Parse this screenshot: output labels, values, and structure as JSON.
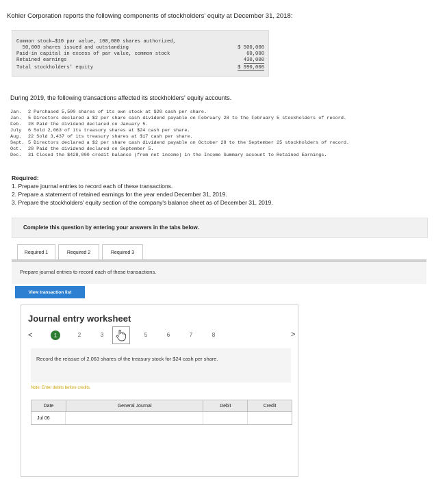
{
  "intro": "Kohler Corporation reports the following components of stockholders' equity at December 31, 2018:",
  "equity": {
    "rows": [
      {
        "label": "Common stock—$10 par value, 100,000 shares authorized,",
        "amount": ""
      },
      {
        "label": "  50,000 shares issued and outstanding",
        "amount": "$ 500,000"
      },
      {
        "label": "Paid-in capital in excess of par value, common stock",
        "amount": "60,000"
      },
      {
        "label": "Retained earnings",
        "amount": "430,000"
      },
      {
        "label": "Total stockholders' equity",
        "amount": "$ 990,000"
      }
    ]
  },
  "during": "During 2019, the following transactions affected its stockholders' equity accounts.",
  "transactions": [
    {
      "month": "Jan.",
      "text": "2 Purchased 5,500 shares of its own stock at $20 cash per share."
    },
    {
      "month": "Jan.",
      "text": "5 Directors declared a $2 per share cash dividend payable on February 28 to the February 5 stockholders of record."
    },
    {
      "month": "Feb.",
      "text": "28 Paid the dividend declared on January 5."
    },
    {
      "month": "July",
      "text": "6 Sold 2,063 of its treasury shares at $24 cash per share."
    },
    {
      "month": "Aug.",
      "text": "22 Sold 3,437 of its treasury shares at $17 cash per share."
    },
    {
      "month": "Sept.",
      "text": "5 Directors declared a $2 per share cash dividend payable on October 28 to the September 25 stockholders of record."
    },
    {
      "month": "Oct.",
      "text": "28 Paid the dividend declared on September 5."
    },
    {
      "month": "Dec.",
      "text": "31 Closed the $428,000 credit balance (from net income) in the Income Summary account to Retained Earnings."
    }
  ],
  "required": {
    "title": "Required:",
    "items": [
      "1. Prepare journal entries to record each of these transactions.",
      "2. Prepare a statement of retained earnings for the year ended December 31, 2019.",
      "3. Prepare the stockholders' equity section of the company's balance sheet as of December 31, 2019."
    ]
  },
  "complete_text": "Complete this question by entering your answers in the tabs below.",
  "tabs": [
    "Required 1",
    "Required 2",
    "Required 3"
  ],
  "instruction": "Prepare journal entries to record each of these transactions.",
  "view_transaction_list": "View transaction list",
  "worksheet": {
    "title": "Journal entry worksheet",
    "prev": "<",
    "next": ">",
    "steps": [
      "1",
      "2",
      "3",
      "4",
      "5",
      "6",
      "7",
      "8"
    ],
    "active_step": "1",
    "description": "Record the reissue of 2,063 shares of the treasury stock for $24 cash per share.",
    "note": "Note: Enter debits before credits.",
    "columns": [
      "Date",
      "General Journal",
      "Debit",
      "Credit"
    ],
    "rows": [
      {
        "date": "Jul 06",
        "account": "",
        "debit": "",
        "credit": ""
      }
    ]
  }
}
